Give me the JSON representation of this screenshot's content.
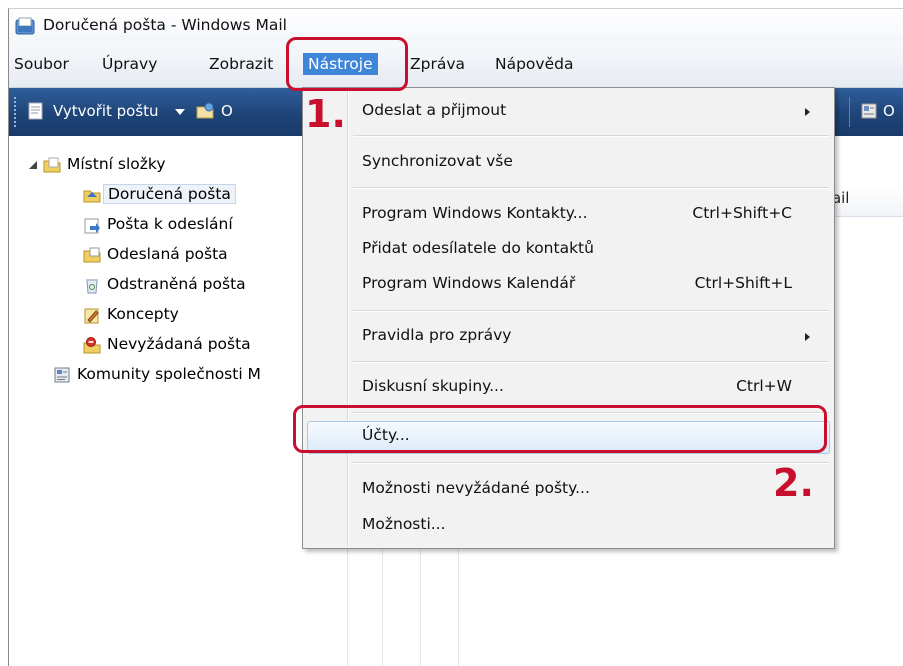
{
  "window": {
    "title": "Doručená pošta - Windows Mail"
  },
  "menubar": {
    "items": [
      "Soubor",
      "Úpravy",
      "Zobrazit",
      "Nástroje",
      "Zpráva",
      "Nápověda"
    ],
    "active": "Nástroje"
  },
  "toolbar": {
    "new_mail_label": "Vytvořit poštu",
    "second_label_partial": "O",
    "right_label_partial": "O"
  },
  "folders": {
    "root": "Místní složky",
    "items": [
      "Doručená pošta",
      "Pošta k odeslání",
      "Odeslaná pošta",
      "Odstraněná pošta",
      "Koncepty",
      "Nevyžádaná pošta"
    ],
    "selected": "Doručená pošta",
    "communities": "Komunity společnosti M"
  },
  "message_list": {
    "column_header_partial": "Mail"
  },
  "tools_menu": {
    "items": [
      {
        "label": "Odeslat a přijmout",
        "shortcut": "",
        "submenu": true
      },
      {
        "label": "Synchronizovat vše",
        "shortcut": "",
        "submenu": false
      },
      {
        "label": "Program Windows Kontakty...",
        "shortcut": "Ctrl+Shift+C",
        "submenu": false
      },
      {
        "label": "Přidat odesílatele do kontaktů",
        "shortcut": "",
        "submenu": false
      },
      {
        "label": "Program Windows Kalendář",
        "shortcut": "Ctrl+Shift+L",
        "submenu": false
      },
      {
        "label": "Pravidla pro zprávy",
        "shortcut": "",
        "submenu": true
      },
      {
        "label": "Diskusní skupiny...",
        "shortcut": "Ctrl+W",
        "submenu": false
      },
      {
        "label": "Účty...",
        "shortcut": "",
        "submenu": false
      },
      {
        "label": "Možnosti nevyžádané pošty...",
        "shortcut": "",
        "submenu": false
      },
      {
        "label": "Možnosti...",
        "shortcut": "",
        "submenu": false
      }
    ],
    "highlighted": "Účty..."
  },
  "annotations": {
    "step1": "1.",
    "step2": "2.",
    "color": "#c8102e"
  },
  "colors": {
    "toolbar": "#1e4478",
    "menu_active": "#3f86d8",
    "highlight_border": "#a9c8ea"
  }
}
